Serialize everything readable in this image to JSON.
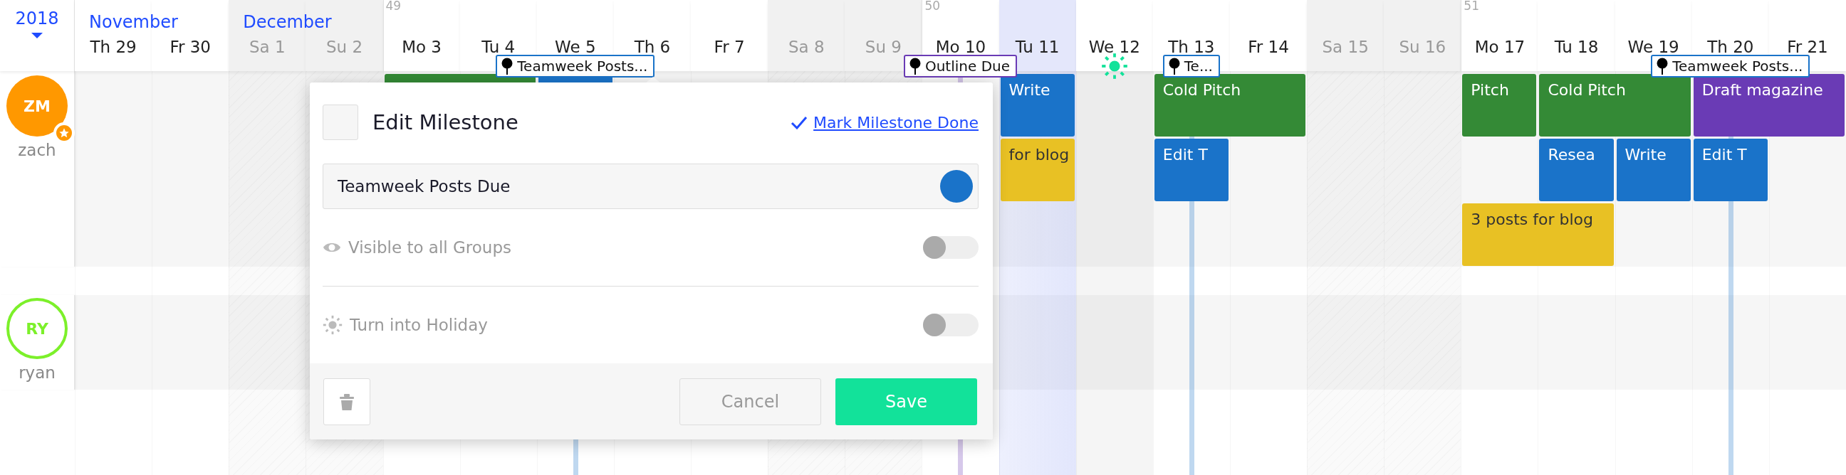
{
  "year": "2018",
  "days": [
    {
      "label": "Th 29",
      "kind": "workday",
      "month": "November"
    },
    {
      "label": "Fr 30",
      "kind": "workday"
    },
    {
      "label": "Sa 1",
      "kind": "weekend",
      "month": "December"
    },
    {
      "label": "Su 2",
      "kind": "weekend"
    },
    {
      "label": "Mo 3",
      "kind": "workday",
      "week": "49"
    },
    {
      "label": "Tu 4",
      "kind": "workday"
    },
    {
      "label": "We 5",
      "kind": "workday",
      "milestone": {
        "label": "Teamweek Posts...",
        "color": "#1a73c9"
      }
    },
    {
      "label": "Th 6",
      "kind": "workday"
    },
    {
      "label": "Fr 7",
      "kind": "workday"
    },
    {
      "label": "Sa 8",
      "kind": "weekend"
    },
    {
      "label": "Su 9",
      "kind": "weekend"
    },
    {
      "label": "Mo 10",
      "kind": "workday",
      "week": "50",
      "milestone": {
        "label": "Outline Due",
        "color": "#6a3bb5"
      }
    },
    {
      "label": "Tu 11",
      "kind": "today"
    },
    {
      "label": "We 12",
      "kind": "holiday"
    },
    {
      "label": "Th 13",
      "kind": "workday",
      "milestone": {
        "label": "Te...",
        "color": "#1a73c9"
      }
    },
    {
      "label": "Fr 14",
      "kind": "workday"
    },
    {
      "label": "Sa 15",
      "kind": "weekend"
    },
    {
      "label": "Su 16",
      "kind": "weekend"
    },
    {
      "label": "Mo 17",
      "kind": "workday",
      "week": "51"
    },
    {
      "label": "Tu 18",
      "kind": "workday"
    },
    {
      "label": "We 19",
      "kind": "workday"
    },
    {
      "label": "Th 20",
      "kind": "workday",
      "milestone": {
        "label": "Teamweek Posts...",
        "color": "#1a73c9"
      }
    },
    {
      "label": "Fr 21",
      "kind": "workday"
    }
  ],
  "users": [
    {
      "initials": "ZM",
      "name": "zach",
      "kind": "filled",
      "color": "#ff9800",
      "starred": true,
      "lanes": [
        [
          {
            "kind": "gap"
          },
          {
            "kind": "gap"
          },
          {
            "kind": "gap"
          },
          {
            "kind": "gap"
          },
          {
            "kind": "event",
            "color": "#348a36"
          },
          {
            "kind": "extend"
          },
          {
            "kind": "event",
            "color": "#1a73c9"
          },
          {
            "kind": "gap"
          },
          {
            "kind": "gap"
          },
          {
            "kind": "gap"
          },
          {
            "kind": "gap"
          },
          {
            "kind": "gap"
          },
          {
            "kind": "event",
            "label": "Write",
            "color": "#1a73c9"
          },
          {
            "kind": "gap"
          },
          {
            "kind": "event",
            "label": "Cold Pitch",
            "color": "#348a36"
          },
          {
            "kind": "extend"
          },
          {
            "kind": "gap"
          },
          {
            "kind": "gap"
          },
          {
            "kind": "event",
            "label": "Pitch",
            "color": "#348a36"
          },
          {
            "kind": "event",
            "label": "Cold Pitch",
            "color": "#348a36"
          },
          {
            "kind": "extend"
          },
          {
            "kind": "event",
            "label": "Draft magazine",
            "color": "#6a3bb5"
          },
          {
            "kind": "extend"
          }
        ],
        [
          {
            "kind": "gap"
          },
          {
            "kind": "gap"
          },
          {
            "kind": "gap"
          },
          {
            "kind": "gap"
          },
          {
            "kind": "gap"
          },
          {
            "kind": "gap"
          },
          {
            "kind": "gap"
          },
          {
            "kind": "gap"
          },
          {
            "kind": "gap"
          },
          {
            "kind": "gap"
          },
          {
            "kind": "gap"
          },
          {
            "kind": "gap"
          },
          {
            "kind": "event",
            "label": "for blog",
            "color": "#e8c124"
          },
          {
            "kind": "gap"
          },
          {
            "kind": "event",
            "label": "Edit T",
            "color": "#1a73c9"
          },
          {
            "kind": "gap"
          },
          {
            "kind": "gap"
          },
          {
            "kind": "gap"
          },
          {
            "kind": "gap"
          },
          {
            "kind": "event",
            "label": "Resea",
            "color": "#1a73c9"
          },
          {
            "kind": "event",
            "label": "Write",
            "color": "#1a73c9"
          },
          {
            "kind": "event",
            "label": "Edit T",
            "color": "#1a73c9"
          }
        ],
        [
          {
            "kind": "gap"
          },
          {
            "kind": "gap"
          },
          {
            "kind": "gap"
          },
          {
            "kind": "gap"
          },
          {
            "kind": "gap"
          },
          {
            "kind": "gap"
          },
          {
            "kind": "gap"
          },
          {
            "kind": "gap"
          },
          {
            "kind": "gap"
          },
          {
            "kind": "gap"
          },
          {
            "kind": "gap"
          },
          {
            "kind": "gap"
          },
          {
            "kind": "gap"
          },
          {
            "kind": "gap"
          },
          {
            "kind": "gap"
          },
          {
            "kind": "gap"
          },
          {
            "kind": "gap"
          },
          {
            "kind": "gap"
          },
          {
            "kind": "event",
            "label": "3 posts for blog",
            "color": "#e8c124"
          },
          {
            "kind": "extend"
          }
        ]
      ]
    },
    {
      "initials": "RY",
      "name": "ryan",
      "kind": "outline",
      "color": "#7cf02a",
      "starred": false
    }
  ],
  "dialog": {
    "title": "Edit Milestone",
    "checked": false,
    "done_link": "Mark Milestone Done",
    "name_field": {
      "value": "Teamweek Posts Due",
      "color": "#1a73c9"
    },
    "options": [
      {
        "label": "Visible to all Groups",
        "kind": "visibility",
        "on": false
      },
      {
        "label": "Turn into Holiday",
        "kind": "holiday",
        "on": false
      }
    ],
    "buttons": [
      {
        "label": "Cancel",
        "kind": "secondary"
      },
      {
        "label": "Save",
        "kind": "primary"
      }
    ]
  }
}
